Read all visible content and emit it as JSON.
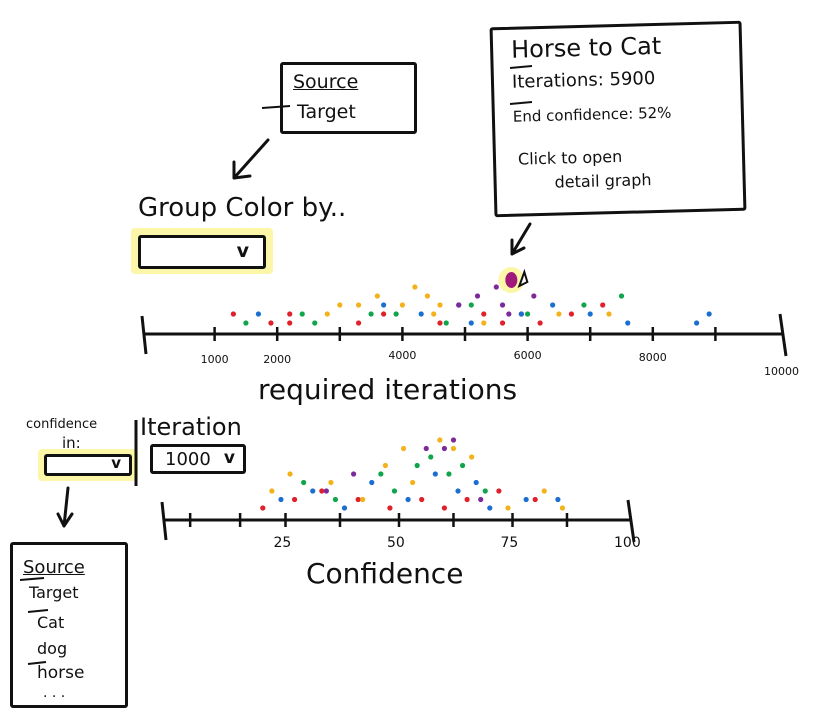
{
  "tooltip": {
    "title": "Horse to Cat",
    "iterations_label": "Iterations:",
    "iterations_value": "5900",
    "end_confidence_label": "End confidence:",
    "end_confidence_value": "52%",
    "hint_line1": "Click to open",
    "hint_line2": "detail graph"
  },
  "source_target_menu": {
    "items": [
      "Source",
      "Target"
    ]
  },
  "group_color": {
    "label": "Group Color by..",
    "selected": ""
  },
  "confidence_in": {
    "label_line1": "confidence",
    "label_line2": "in:",
    "selected": "",
    "options": [
      "Source",
      "Target",
      "Cat",
      "dog",
      "horse",
      ". . ."
    ]
  },
  "iteration_select": {
    "label": "Iteration",
    "selected": "1000"
  },
  "chevron": "v",
  "colors": {
    "red": "#e0202a",
    "blue": "#1a6fd1",
    "green": "#10a54a",
    "yellow": "#f3b21a",
    "purple": "#7a2a9a",
    "highlight": "#fbf6a8",
    "selected_point": "#a0197a"
  },
  "chart_data": [
    {
      "type": "scatter",
      "xlabel": "required iterations",
      "tick_labels": [
        "1000",
        "2000",
        "4000",
        "6000",
        "8000",
        "10000"
      ],
      "tick_values": [
        1000,
        2000,
        4000,
        6000,
        8000,
        10000
      ],
      "xlim": [
        0,
        10000
      ],
      "highlighted_point": {
        "x": 5900,
        "label": "Horse to Cat"
      },
      "series": [
        {
          "color": "red",
          "x": [
            1300,
            1900,
            2200,
            2200,
            3300,
            3700,
            4600,
            5300,
            5600,
            5900,
            6200,
            6700,
            7200
          ],
          "level": [
            2,
            1,
            1,
            2,
            1,
            2,
            1,
            2,
            1,
            2,
            1,
            2,
            3
          ]
        },
        {
          "color": "blue",
          "x": [
            1700,
            3700,
            4300,
            4900,
            5100,
            5900,
            6400,
            7000,
            7600,
            8700,
            8900
          ],
          "level": [
            2,
            3,
            2,
            3,
            1,
            2,
            3,
            2,
            1,
            1,
            2
          ]
        },
        {
          "color": "green",
          "x": [
            1500,
            2400,
            2600,
            3500,
            3900,
            4700,
            5100,
            6000,
            6900,
            7500
          ],
          "level": [
            1,
            2,
            1,
            2,
            2,
            1,
            3,
            2,
            3,
            4
          ]
        },
        {
          "color": "yellow",
          "x": [
            2800,
            3000,
            3300,
            3600,
            4000,
            4200,
            4400,
            4500,
            4600,
            5300,
            6500,
            7300
          ],
          "level": [
            2,
            3,
            3,
            4,
            3,
            5,
            4,
            2,
            3,
            1,
            2,
            2
          ]
        },
        {
          "color": "purple",
          "x": [
            4900,
            5200,
            5500,
            5600,
            5700,
            6100
          ],
          "level": [
            3,
            4,
            5,
            3,
            2,
            4
          ]
        }
      ]
    },
    {
      "type": "scatter",
      "xlabel": "Confidence",
      "tick_labels": [
        "25",
        "50",
        "75",
        "100"
      ],
      "tick_values": [
        25,
        50,
        75,
        100
      ],
      "xlim": [
        0,
        100
      ],
      "series": [
        {
          "color": "red",
          "x": [
            20,
            27,
            33,
            41,
            48,
            55,
            60,
            65,
            72,
            80
          ],
          "level": [
            1,
            2,
            3,
            2,
            1,
            2,
            1,
            2,
            3,
            2
          ]
        },
        {
          "color": "blue",
          "x": [
            24,
            31,
            38,
            44,
            52,
            58,
            63,
            67,
            70,
            78,
            85
          ],
          "level": [
            2,
            3,
            1,
            4,
            2,
            5,
            3,
            4,
            1,
            2,
            2
          ]
        },
        {
          "color": "green",
          "x": [
            29,
            36,
            46,
            49,
            54,
            57,
            61,
            64,
            69
          ],
          "level": [
            4,
            2,
            5,
            3,
            6,
            7,
            5,
            6,
            3
          ]
        },
        {
          "color": "yellow",
          "x": [
            22,
            26,
            35,
            42,
            47,
            51,
            53,
            59,
            62,
            66,
            74,
            82,
            86
          ],
          "level": [
            3,
            5,
            4,
            2,
            6,
            8,
            4,
            9,
            8,
            7,
            1,
            3,
            1
          ]
        },
        {
          "color": "purple",
          "x": [
            34,
            40,
            56,
            60,
            62,
            68
          ],
          "level": [
            3,
            5,
            8,
            8,
            9,
            2
          ]
        }
      ]
    }
  ]
}
